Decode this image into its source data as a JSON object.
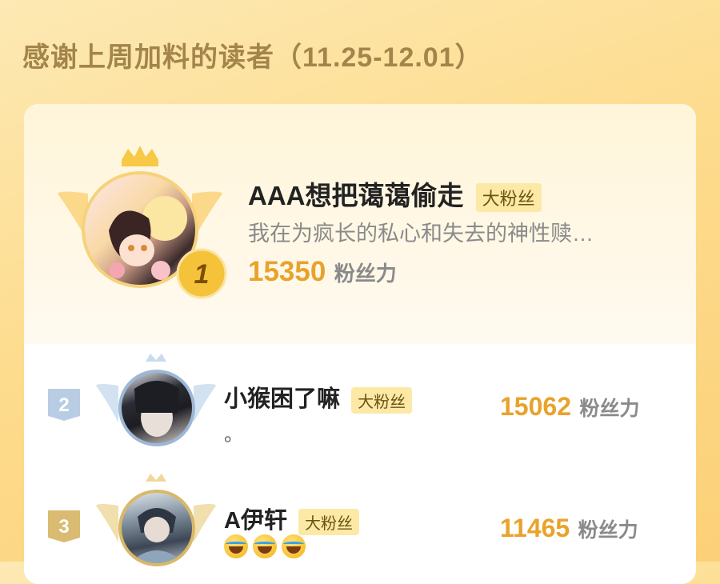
{
  "header": {
    "title": "感谢上周加料的读者（11.25-12.01）"
  },
  "colors": {
    "accent": "#e8a32c",
    "badge_bg": "#fce9a6",
    "title_color": "#a3844a"
  },
  "leaderboard": [
    {
      "rank": "1",
      "name": "AAA想把蔼蔼偷走",
      "badge": "大粉丝",
      "signature": "我在为疯长的私心和失去的神性赎…",
      "score": "15350",
      "score_unit": "粉丝力"
    },
    {
      "rank": "2",
      "name": "小猴困了嘛",
      "badge": "大粉丝",
      "signature": "。",
      "score": "15062",
      "score_unit": "粉丝力"
    },
    {
      "rank": "3",
      "name": "A伊轩",
      "badge": "大粉丝",
      "signature_emojis": [
        "joy-emoji",
        "joy-emoji",
        "joy-emoji"
      ],
      "score": "11465",
      "score_unit": "粉丝力"
    }
  ]
}
